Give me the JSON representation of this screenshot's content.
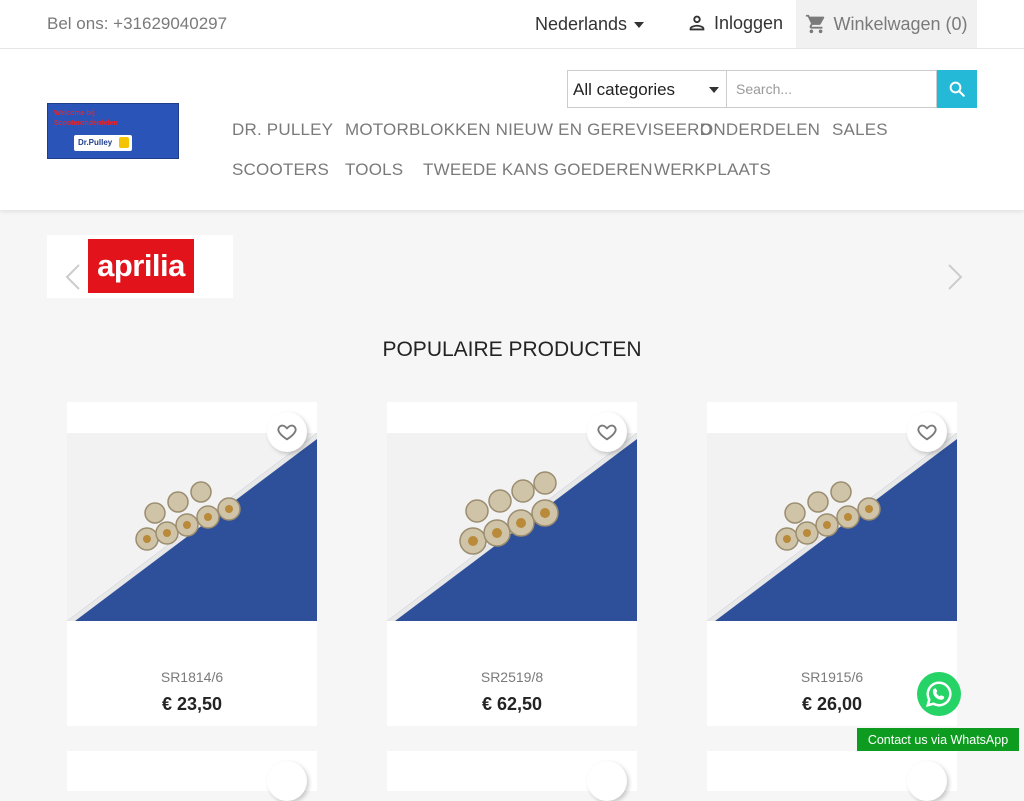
{
  "topbar": {
    "phone": "Bel ons: +31629040297",
    "language": "Nederlands",
    "login": "Inloggen",
    "cart": "Winkelwagen (0)"
  },
  "search": {
    "category": "All categories",
    "placeholder": "Search..."
  },
  "logo": {
    "line1": "Welcome bij",
    "line2": "Scooteronderdelen",
    "badge": "Dr.Pulley"
  },
  "nav": {
    "items": [
      "DR. PULLEY",
      "MOTORBLOKKEN NIEUW EN GEREVISEERD",
      "ONDERDELEN",
      "SALES",
      "SCOOTERS",
      "TOOLS",
      "TWEEDE KANS GOEDEREN",
      "WERKPLAATS"
    ]
  },
  "brand_slider": {
    "brand": "aprilia"
  },
  "section": {
    "title": "POPULAIRE PRODUCTEN"
  },
  "products": [
    {
      "ref": "SR1814/6",
      "price": "€ 23,50"
    },
    {
      "ref": "SR2519/8",
      "price": "€ 62,50"
    },
    {
      "ref": "SR1915/6",
      "price": "€ 26,00"
    }
  ],
  "whatsapp": {
    "label": "Contact us via WhatsApp"
  },
  "colors": {
    "accent": "#24b9d7",
    "whatsapp": "#25d366",
    "whatsapp_label": "#0e9c20",
    "aprilia": "#e2131a",
    "product_bg": "#2e4f99"
  }
}
